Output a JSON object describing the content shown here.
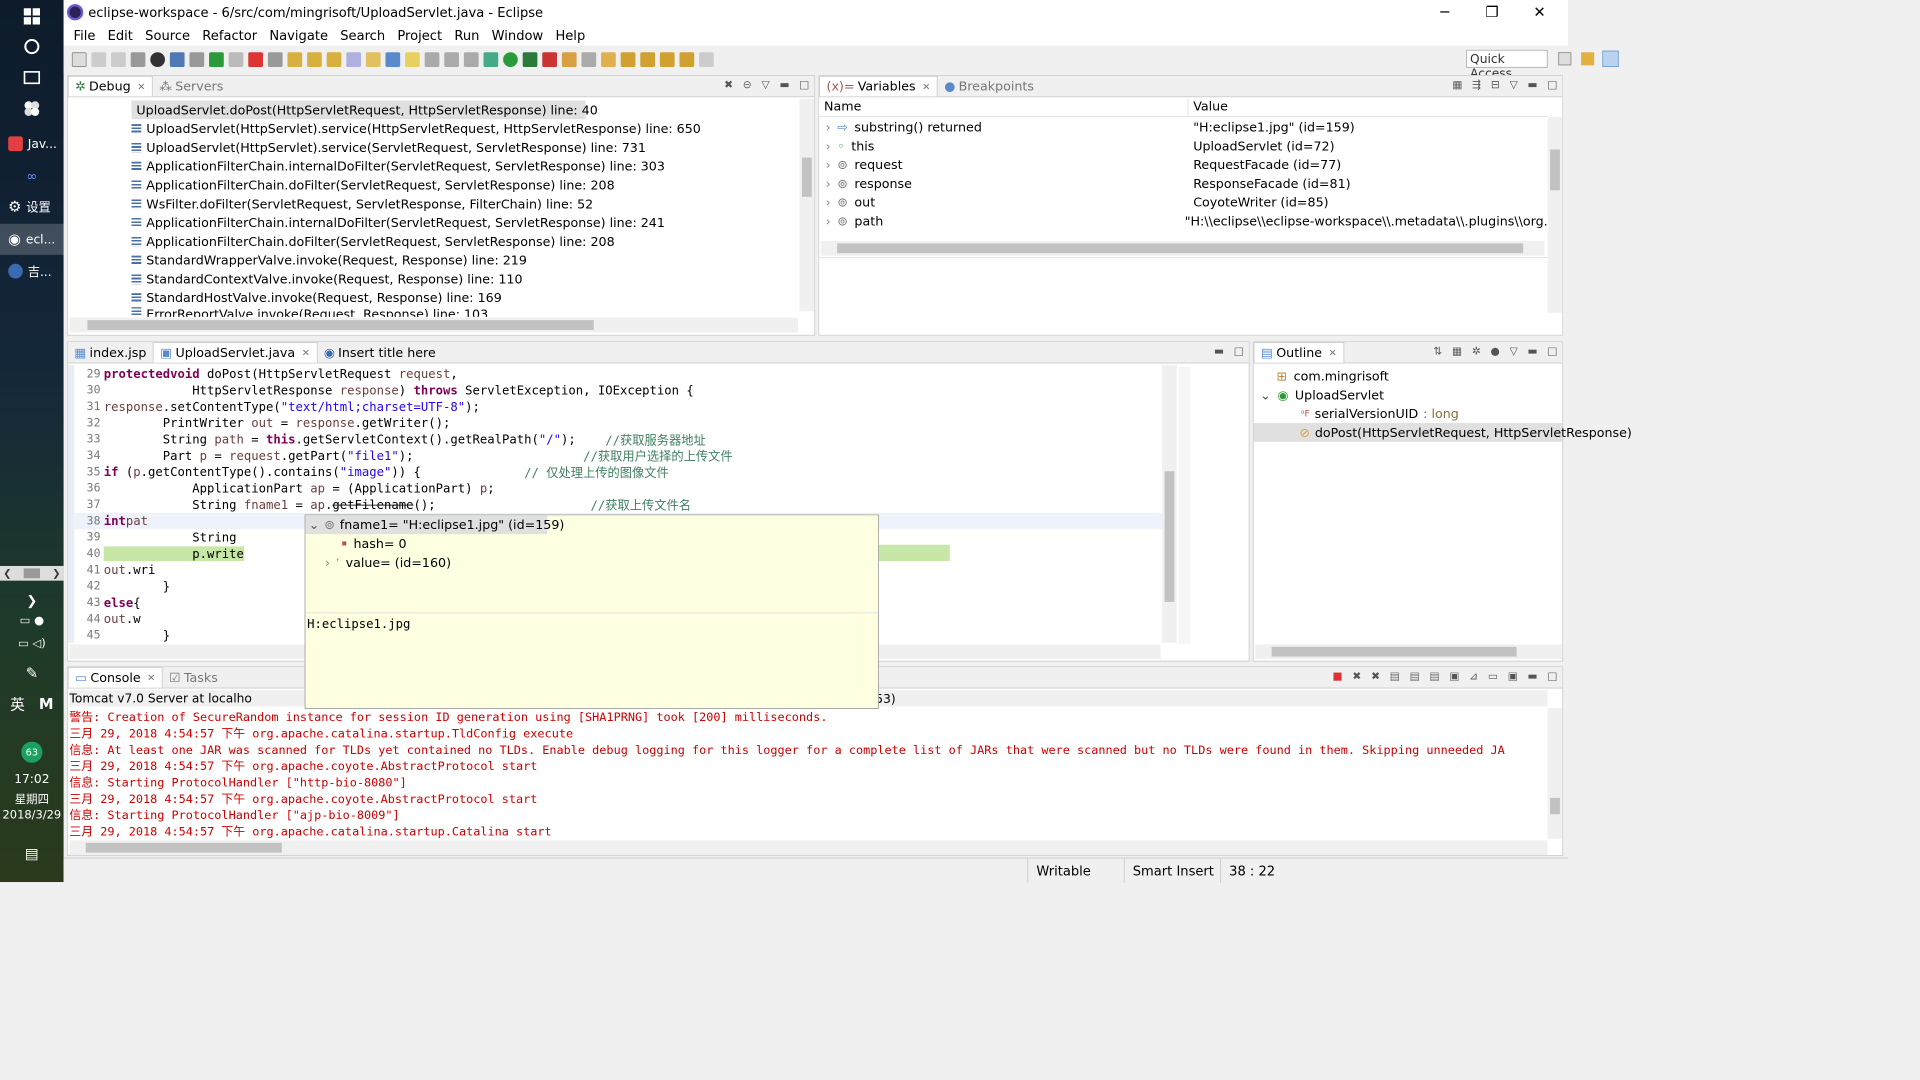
{
  "taskbar": {
    "apps": [
      {
        "label": "Jav...",
        "color": "#e04040"
      },
      {
        "label": "设置",
        "color": "#888"
      },
      {
        "label": "ecl...",
        "color": "#2c2255"
      },
      {
        "label": "吉...",
        "color": "#3a6ab0"
      }
    ],
    "ime": "英",
    "ime2": "M",
    "badge": "63",
    "time": "17:02",
    "weekday": "星期四",
    "date": "2018/3/29"
  },
  "window": {
    "title": "eclipse-workspace - 6/src/com/mingrisoft/UploadServlet.java - Eclipse",
    "controls": {
      "minimize": "─",
      "restore": "❐",
      "close": "✕"
    }
  },
  "menu": [
    "File",
    "Edit",
    "Source",
    "Refactor",
    "Navigate",
    "Search",
    "Project",
    "Run",
    "Window",
    "Help"
  ],
  "quick_access": "Quick Access",
  "debug_view": {
    "tabs": [
      {
        "label": "Debug",
        "selected": true
      },
      {
        "label": "Servers",
        "selected": false
      }
    ],
    "frames": [
      "UploadServlet.doPost(HttpServletRequest, HttpServletResponse) line: 40",
      "UploadServlet(HttpServlet).service(HttpServletRequest, HttpServletResponse) line: 650",
      "UploadServlet(HttpServlet).service(ServletRequest, ServletResponse) line: 731",
      "ApplicationFilterChain.internalDoFilter(ServletRequest, ServletResponse) line: 303",
      "ApplicationFilterChain.doFilter(ServletRequest, ServletResponse) line: 208",
      "WsFilter.doFilter(ServletRequest, ServletResponse, FilterChain) line: 52",
      "ApplicationFilterChain.internalDoFilter(ServletRequest, ServletResponse) line: 241",
      "ApplicationFilterChain.doFilter(ServletRequest, ServletResponse) line: 208",
      "StandardWrapperValve.invoke(Request, Response) line: 219",
      "StandardContextValve.invoke(Request, Response) line: 110",
      "StandardHostValve.invoke(Request, Response) line: 169",
      "ErrorReportValve.invoke(Request, Response) line: 103"
    ]
  },
  "variables_view": {
    "tabs": [
      {
        "label": "Variables",
        "selected": true
      },
      {
        "label": "Breakpoints",
        "selected": false
      }
    ],
    "columns": [
      "Name",
      "Value"
    ],
    "rows": [
      {
        "name": "substring() returned",
        "value": "\"H:eclipse1.jpg\" (id=159)"
      },
      {
        "name": "this",
        "value": "UploadServlet  (id=72)"
      },
      {
        "name": "request",
        "value": "RequestFacade  (id=77)"
      },
      {
        "name": "response",
        "value": "ResponseFacade  (id=81)"
      },
      {
        "name": "out",
        "value": "CoyoteWriter  (id=85)"
      },
      {
        "name": "path",
        "value": "\"H:\\\\eclipse\\\\eclipse-workspace\\\\.metadata\\\\.plugins\\\\org."
      }
    ]
  },
  "editor": {
    "tabs": [
      {
        "label": "index.jsp",
        "selected": false
      },
      {
        "label": "UploadServlet.java",
        "selected": true
      },
      {
        "label": "Insert title here",
        "selected": false
      }
    ]
  },
  "outline": {
    "tab": "Outline",
    "package": "com.mingrisoft",
    "class": "UploadServlet",
    "field": "serialVersionUID",
    "field_type": " : long",
    "method": "doPost(HttpServletRequest, HttpServletResponse)"
  },
  "popup": {
    "root": "fname1= \"H:eclipse1.jpg\" (id=159)",
    "child1": "hash= 0",
    "child2": "value= (id=160)",
    "detail": "H:eclipse1.jpg"
  },
  "console_view": {
    "tabs": [
      {
        "label": "Console",
        "selected": true
      },
      {
        "label": "Tasks",
        "selected": false
      }
    ],
    "header": "Tomcat v7.0 Server at localho",
    "header_tail": "下午4:54:53)",
    "lines": [
      "警告: Creation of SecureRandom instance for session ID generation using [SHA1PRNG] took [200] milliseconds.",
      "三月 29, 2018 4:54:57 下午 org.apache.catalina.startup.TldConfig execute",
      "信息: At least one JAR was scanned for TLDs yet contained no TLDs. Enable debug logging for this logger for a complete list of JARs that were scanned but no TLDs were found in them. Skipping unneeded JA",
      "三月 29, 2018 4:54:57 下午 org.apache.coyote.AbstractProtocol start",
      "信息: Starting ProtocolHandler [\"http-bio-8080\"]",
      "三月 29, 2018 4:54:57 下午 org.apache.coyote.AbstractProtocol start",
      "信息: Starting ProtocolHandler [\"ajp-bio-8009\"]",
      "三月 29, 2018 4:54:57 下午 org.apache.catalina.startup.Catalina start"
    ]
  },
  "status": {
    "writable": "Writable",
    "insert": "Smart Insert",
    "position": "38 : 22"
  }
}
